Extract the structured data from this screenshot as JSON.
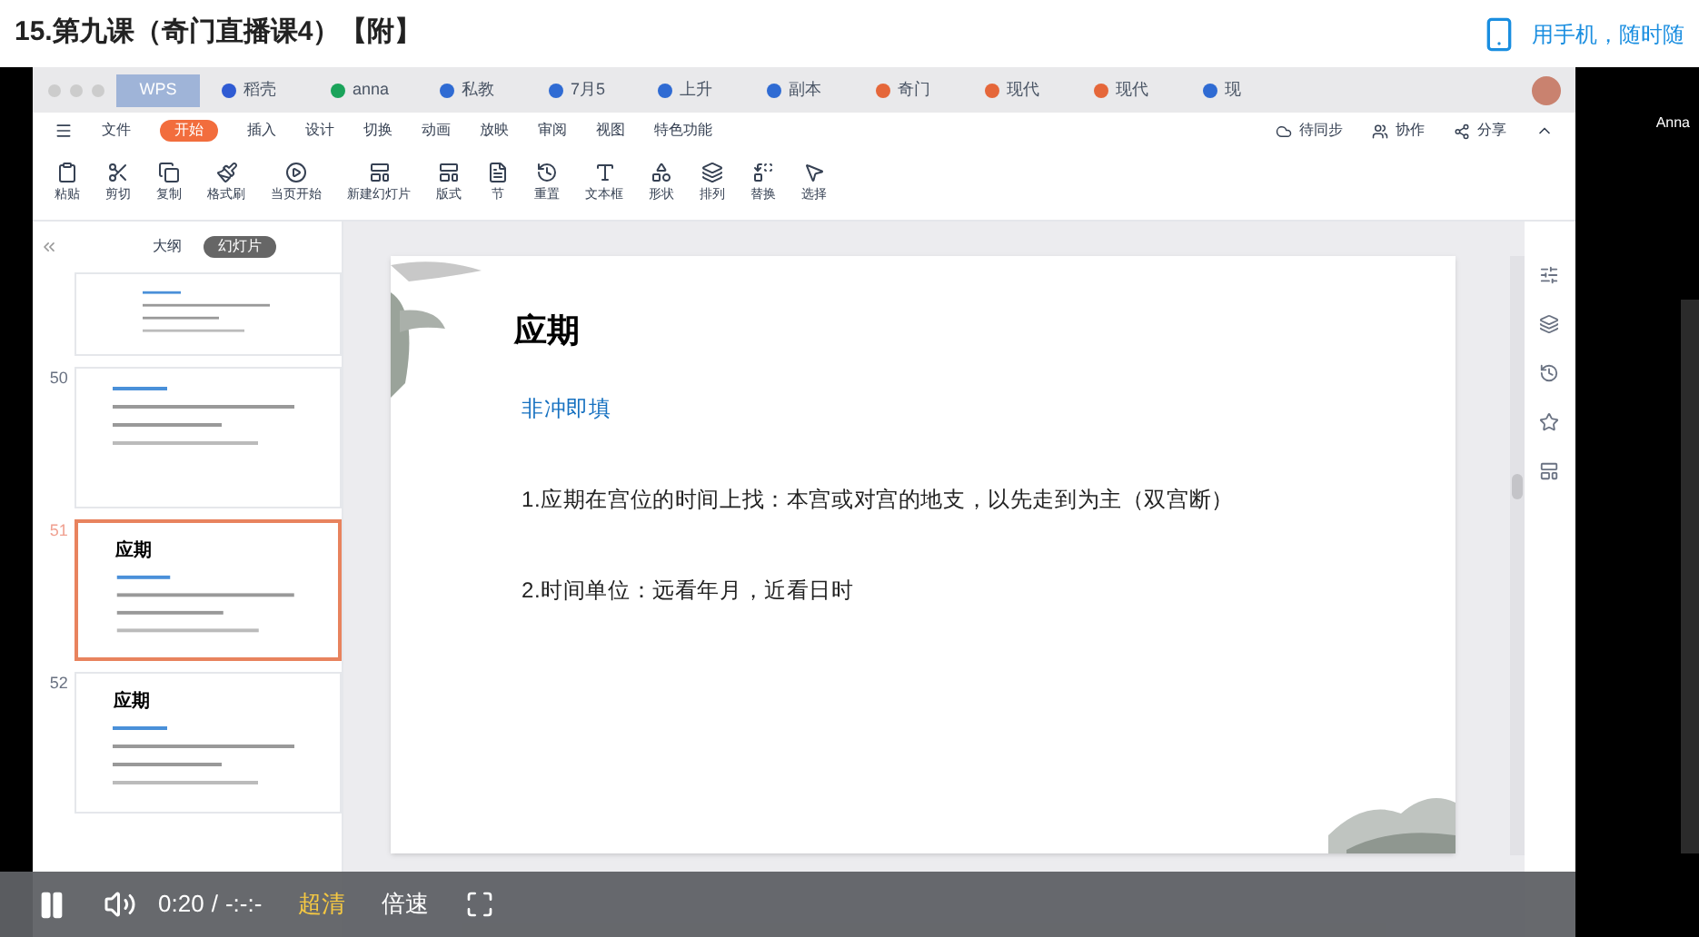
{
  "page_title": "15.第九课（奇门直播课4）【附】",
  "mobile_link": "用手机，随时随",
  "wps": {
    "tabs": [
      {
        "label": "WPS",
        "kind": "home",
        "selected": true
      },
      {
        "label": "稻壳",
        "kind": "docer",
        "selected": false
      },
      {
        "label": "anna",
        "kind": "sheet",
        "selected": false
      },
      {
        "label": "私教",
        "kind": "doc",
        "selected": false
      },
      {
        "label": "7月5",
        "kind": "doc",
        "selected": false
      },
      {
        "label": "上升",
        "kind": "doc",
        "selected": false
      },
      {
        "label": "副本",
        "kind": "doc",
        "selected": false
      },
      {
        "label": "奇门",
        "kind": "ppt",
        "selected": false
      },
      {
        "label": "现代",
        "kind": "ppt",
        "selected": false
      },
      {
        "label": "现代",
        "kind": "ppt",
        "selected": false
      },
      {
        "label": "现",
        "kind": "doc",
        "selected": false
      }
    ],
    "menu": [
      {
        "label": "文件",
        "selected": false
      },
      {
        "label": "开始",
        "selected": true
      },
      {
        "label": "插入",
        "selected": false
      },
      {
        "label": "设计",
        "selected": false
      },
      {
        "label": "切换",
        "selected": false
      },
      {
        "label": "动画",
        "selected": false
      },
      {
        "label": "放映",
        "selected": false
      },
      {
        "label": "审阅",
        "selected": false
      },
      {
        "label": "视图",
        "selected": false
      },
      {
        "label": "特色功能",
        "selected": false
      }
    ],
    "menu_right": [
      "待同步",
      "协作",
      "分享"
    ],
    "ribbon": [
      "粘贴",
      "剪切",
      "复制",
      "格式刷",
      "当页开始",
      "新建幻灯片",
      "版式",
      "节",
      "重置",
      "文本框",
      "形状",
      "排列",
      "替换",
      "选择"
    ],
    "panel_tabs": [
      {
        "label": "大纲",
        "selected": false
      },
      {
        "label": "幻灯片",
        "selected": true
      }
    ],
    "thumbnails": [
      {
        "selected": false
      },
      {
        "number": "50",
        "selected": false
      },
      {
        "number": "51",
        "title": "应期",
        "selected": true
      },
      {
        "number": "52",
        "title": "应期",
        "selected": false
      }
    ],
    "slide": {
      "title": "应期",
      "subtitle": "非冲即填",
      "points": [
        "1.应期在宫位的时间上找：本宫或对宫的地支，以先走到为主（双宫断）",
        "2.时间单位：远看年月，近看日时"
      ]
    }
  },
  "viewer_name": "Anna",
  "player": {
    "playing": true,
    "time": "0:20",
    "separator": "/",
    "duration": "-:-:-",
    "quality": "超清",
    "speed": "倍速"
  }
}
